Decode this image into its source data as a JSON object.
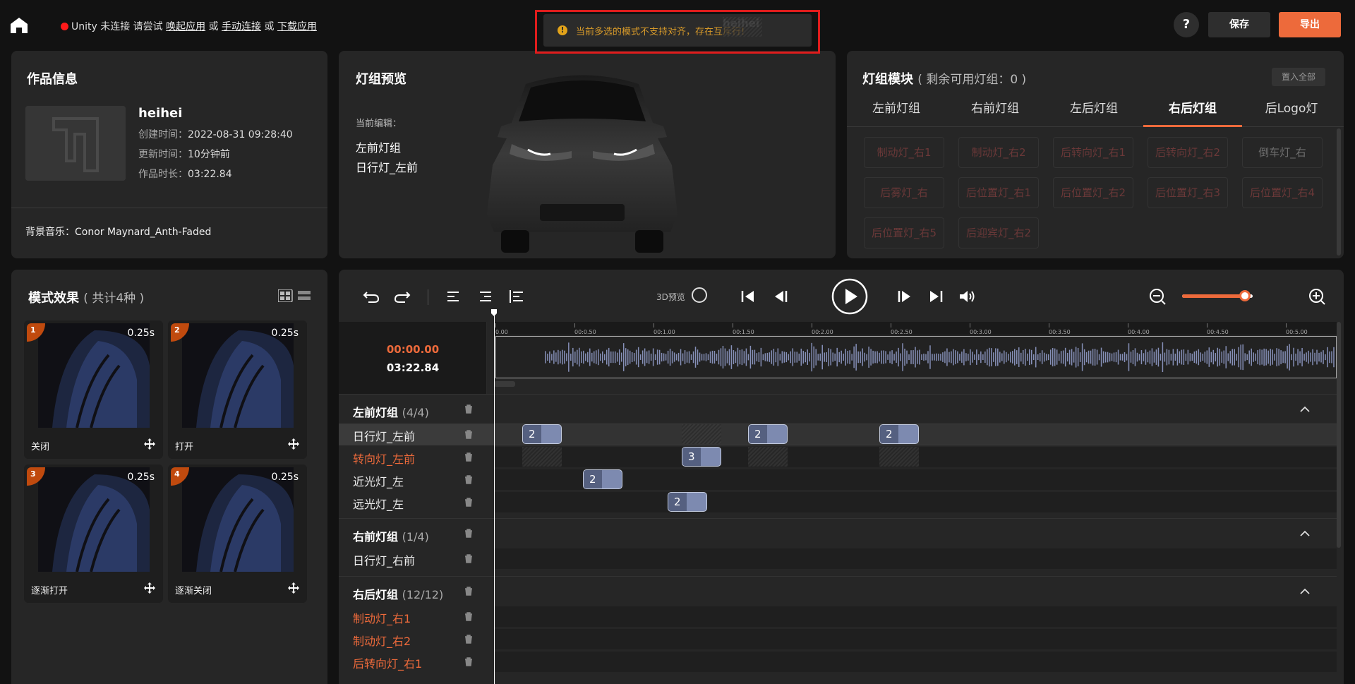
{
  "header": {
    "unity_status_prefix": "Unity 未连接 请尝试",
    "link_wake": "唤起应用",
    "or1": "或",
    "link_manual": "手动连接",
    "or2": "或",
    "link_download": "下载应用",
    "toast_message": "当前多选的模式不支持对齐，存在互斥行!",
    "toast_ghost": "heihei",
    "help_label": "?",
    "save_label": "保存",
    "export_label": "导出",
    "colors": {
      "accent": "#ed6a3b",
      "status_red": "#ff1a1a",
      "warning": "#e2a31a"
    }
  },
  "work_info": {
    "title": "作品信息",
    "name": "heihei",
    "created_key": "创建时间：",
    "created_val": "2022-08-31 09:28:40",
    "updated_key": "更新时间：",
    "updated_val": "10分钟前",
    "duration_key": "作品时长：",
    "duration_val": "03:22.84",
    "bg_music": "背景音乐：Conor Maynard_Anth-Faded"
  },
  "preview": {
    "title": "灯组预览",
    "current_edit_label": "当前编辑：",
    "current_group": "左前灯组",
    "current_light": "日行灯_左前"
  },
  "modules": {
    "title": "灯组模块",
    "subtitle": "( 剩余可用灯组：0 )",
    "set_all": "置入全部",
    "tabs": [
      "左前灯组",
      "右前灯组",
      "左后灯组",
      "右后灯组",
      "后Logo灯"
    ],
    "active_tab": "右后灯组",
    "chips": [
      "制动灯_右1",
      "制动灯_右2",
      "后转向灯_右1",
      "后转向灯_右2",
      "倒车灯_右",
      "后雾灯_右",
      "后位置灯_右1",
      "后位置灯_右2",
      "后位置灯_右3",
      "后位置灯_右4",
      "后位置灯_右5",
      "后迎宾灯_右2"
    ]
  },
  "effects": {
    "title": "模式效果",
    "subtitle": "( 共计4种 )",
    "items": [
      {
        "index": "1",
        "duration": "0.25s",
        "name": "关闭"
      },
      {
        "index": "2",
        "duration": "0.25s",
        "name": "打开"
      },
      {
        "index": "3",
        "duration": "0.25s",
        "name": "逐渐打开"
      },
      {
        "index": "4",
        "duration": "0.25s",
        "name": "逐渐关闭"
      }
    ]
  },
  "timeline": {
    "preview_3d_label": "3D预览",
    "zoom_level": 0.87,
    "current_time": "00:00.00",
    "total_time": "03:22.84",
    "ruler_ticks": [
      "0.00",
      "00:0.50",
      "00:1.00",
      "00:1.50",
      "00:2.00",
      "00:2.50",
      "00:3.00",
      "00:3.50",
      "00:4.00",
      "00:4.50",
      "00:5.00"
    ],
    "groups": [
      {
        "name": "左前灯组",
        "count": "(4/4)",
        "tracks": [
          {
            "label": "日行灯_左前",
            "clips": [
              "2",
              "2",
              "2"
            ]
          },
          {
            "label": "转向灯_左前",
            "clips": [
              "3"
            ]
          },
          {
            "label": "近光灯_左",
            "clips": [
              "2"
            ]
          },
          {
            "label": "远光灯_左",
            "clips": [
              "2"
            ]
          }
        ]
      },
      {
        "name": "右前灯组",
        "count": "(1/4)",
        "tracks": [
          {
            "label": "日行灯_右前"
          }
        ]
      },
      {
        "name": "右后灯组",
        "count": "(12/12)",
        "tracks": [
          {
            "label": "制动灯_右1"
          },
          {
            "label": "制动灯_右2"
          },
          {
            "label": "后转向灯_右1"
          }
        ]
      }
    ]
  }
}
